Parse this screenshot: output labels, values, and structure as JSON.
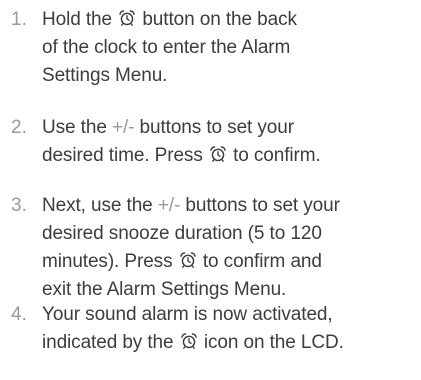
{
  "steps": [
    {
      "number": "1.",
      "parts": [
        "Hold the ",
        "alarm-clock-icon",
        " button on the back of the clock to enter the Alarm Settings Menu."
      ]
    },
    {
      "number": "2.",
      "parts": [
        "Use the ",
        "+/-",
        " buttons to set your desired time. Press ",
        "alarm-clock-icon",
        " to confirm."
      ]
    },
    {
      "number": "3.",
      "parts": [
        "Next, use the ",
        "+/-",
        " buttons to set your desired snooze duration (5 to 120 minutes). Press ",
        "alarm-clock-icon",
        " to confirm and exit the Alarm Settings Menu."
      ]
    },
    {
      "number": "4.",
      "parts": [
        "Your sound alarm is now activated, indicated by the ",
        "alarm-clock-icon",
        " icon on the LCD."
      ]
    }
  ],
  "text_1a": "Hold the ",
  "text_1b": " button on the back",
  "text_1c": "of the clock to enter the Alarm",
  "text_1d": "Settings Menu.",
  "text_2a": "Use the ",
  "text_2pm": "+/-",
  "text_2b": " buttons to set your",
  "text_2c": "desired time. Press ",
  "text_2d": " to confirm.",
  "text_3a": "Next, use the ",
  "text_3pm": "+/-",
  "text_3b": " buttons to set your",
  "text_3c": "desired snooze duration (5 to 120",
  "text_3d": "minutes). Press ",
  "text_3e": " to confirm and",
  "text_3f": "exit the Alarm Settings Menu.",
  "text_4a": "Your sound alarm is now activated,",
  "text_4b": "indicated by the ",
  "text_4c": " icon on the LCD.",
  "num_1": "1.",
  "num_2": "2.",
  "num_3": "3.",
  "num_4": "4."
}
